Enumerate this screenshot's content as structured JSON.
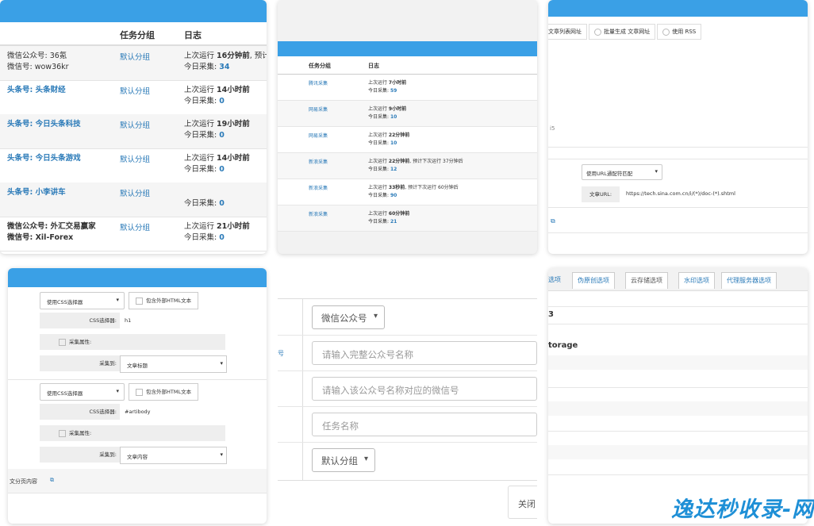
{
  "panel1": {
    "headers": {
      "group": "任务分组",
      "log": "日志"
    },
    "rows": [
      {
        "name1": "微信公众号: 36氪",
        "name2": "微信号: wow36kr",
        "group": "默认分组",
        "log1_prefix": "上次运行 ",
        "log1_bold": "16分钟前",
        "log1_suffix": ", 预计",
        "log2_prefix": "今日采集: ",
        "log2_val": "34"
      },
      {
        "name1": "头条号: 头条财经",
        "name2": "",
        "group": "默认分组",
        "log1_prefix": "上次运行 ",
        "log1_bold": "14小时前",
        "log1_suffix": "",
        "log2_prefix": "今日采集: ",
        "log2_val": "0"
      },
      {
        "name1": "头条号: 今日头条科技",
        "name2": "",
        "group": "默认分组",
        "log1_prefix": "上次运行 ",
        "log1_bold": "19小时前",
        "log1_suffix": "",
        "log2_prefix": "今日采集: ",
        "log2_val": "0"
      },
      {
        "name1": "头条号: 今日头条游戏",
        "name2": "",
        "group": "默认分组",
        "log1_prefix": "上次运行 ",
        "log1_bold": "14小时前",
        "log1_suffix": "",
        "log2_prefix": "今日采集: ",
        "log2_val": "0"
      },
      {
        "name1": "头条号: 小李讲车",
        "name2": "",
        "group": "默认分组",
        "log1_prefix": "",
        "log1_bold": "",
        "log1_suffix": "",
        "log2_prefix": "今日采集: ",
        "log2_val": "0"
      },
      {
        "name1": "微信公众号: 外汇交易赢家",
        "name2": "微信号: Xil-Forex",
        "group": "默认分组",
        "log1_prefix": "上次运行 ",
        "log1_bold": "21小时前",
        "log1_suffix": "",
        "log2_prefix": "今日采集: ",
        "log2_val": "0"
      }
    ]
  },
  "panel2": {
    "headers": {
      "group": "任务分组",
      "log": "日志"
    },
    "rows": [
      {
        "group": "腾讯采集",
        "log1_prefix": "上次运行 ",
        "log1_bold": "7小时前",
        "log1_suffix": "",
        "log2_prefix": "今日采集: ",
        "log2_val": "59"
      },
      {
        "group": "网易采集",
        "log1_prefix": "上次运行 ",
        "log1_bold": "9小时前",
        "log1_suffix": "",
        "log2_prefix": "今日采集: ",
        "log2_val": "10"
      },
      {
        "group": "网易采集",
        "log1_prefix": "上次运行 ",
        "log1_bold": "22分钟前",
        "log1_suffix": "",
        "log2_prefix": "今日采集: ",
        "log2_val": "10"
      },
      {
        "group": "新浪采集",
        "log1_prefix": "上次运行 ",
        "log1_bold": "22分钟前",
        "log1_suffix": ", 预计下次运行 37分钟后",
        "log2_prefix": "今日采集: ",
        "log2_val": "12"
      },
      {
        "group": "新浪采集",
        "log1_prefix": "上次运行 ",
        "log1_bold": "33秒前",
        "log1_suffix": ", 预计下次运行 60分钟后",
        "log2_prefix": "今日采集: ",
        "log2_val": "90"
      },
      {
        "group": "新浪采集",
        "log1_prefix": "上次运行 ",
        "log1_bold": "60分钟前",
        "log1_suffix": "",
        "log2_prefix": "今日采集: ",
        "log2_val": "21"
      }
    ]
  },
  "panel3": {
    "radio1": "文章列表网址",
    "radio2": "批量生成 文章网址",
    "radio3": "使用 RSS",
    "small_text": "i5",
    "match_select": "使用URL通配符匹配",
    "url_label": "文章URL:",
    "url_value": "https://tech.sina.com.cn/i/(*)/doc-(*).shtml"
  },
  "panel4": {
    "groups": [
      {
        "selector": "使用CSS选择器",
        "include_html": "包含外部HTML文本",
        "css_label": "CSS选择器:",
        "css_value": "h1",
        "attr_label": "采集属性:",
        "to_label": "采集到:",
        "to_value": "文章标题"
      },
      {
        "selector": "使用CSS选择器",
        "include_html": "包含外部HTML文本",
        "css_label": "CSS选择器:",
        "css_value": "#artibody",
        "attr_label": "采集属性:",
        "to_label": "采集到:",
        "to_value": "文章内容"
      }
    ],
    "footer_text": "文分页内容"
  },
  "panel5": {
    "account_type": "微信公众号",
    "name_placeholder": "请输入完整公众号名称",
    "wechat_placeholder": "请输入该公众号名称对应的微信号",
    "task_placeholder": "任务名称",
    "group_value": "默认分组",
    "close_label": "关闭"
  },
  "panel6": {
    "tabs": [
      "选项",
      "伪原创选项",
      "云存储选项",
      "水印选项",
      "代理服务器选项"
    ],
    "active_tab": 2,
    "line1": "3",
    "line2": "torage"
  },
  "watermark": "逸达秒收录-网"
}
